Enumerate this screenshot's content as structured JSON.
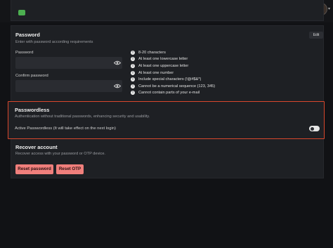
{
  "topbar": {
    "avatar_icon": "user-avatar",
    "chevron_icon": "chevron-down-icon"
  },
  "prev_card": {
    "status_icon": "green-status-icon"
  },
  "password": {
    "title": "Password",
    "subtitle": "Enter with password according requirements",
    "edit_label": "Edit",
    "password_label": "Password",
    "confirm_label": "Confirm password",
    "eye_icon": "eye-icon",
    "requirements": [
      "8-20 characters",
      "At least one lowercase letter",
      "At least one uppercase letter",
      "At least one number",
      "Include special characters (!@#$&*)",
      "Cannot be a numerical sequence (123, 345)",
      "Cannot contain parts of your e-mail"
    ],
    "requirement_icon": "info-icon"
  },
  "passwordless": {
    "title": "Passwordless",
    "subtitle": "Authentication without traditional passwords, enhancing security and usability.",
    "toggle_label": "Active Passwordless (It will take effect on the next login)",
    "toggle_on": false,
    "highlight_color": "#d9472c"
  },
  "recover": {
    "title": "Recover account",
    "subtitle": "Recover access with your password or OTP device.",
    "reset_password_label": "Reset password",
    "reset_otp_label": "Reset OTP",
    "button_color": "#f07f7c"
  }
}
